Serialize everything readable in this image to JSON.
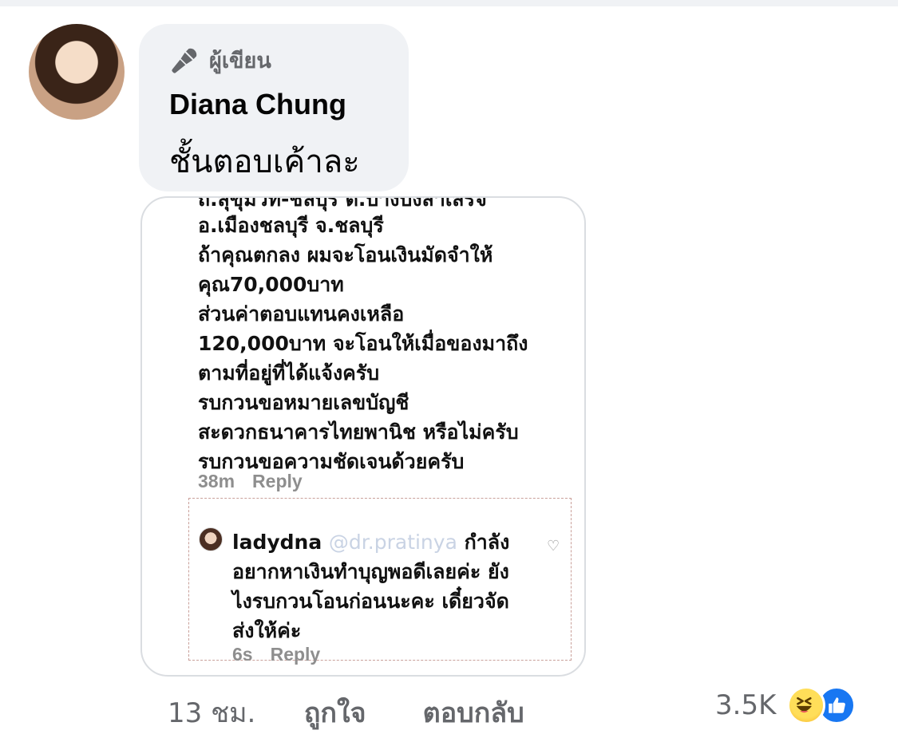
{
  "comment": {
    "badge_label": "ผู้เขียน",
    "author": "Diana Chung",
    "text": "ชั้นตอบเค้าละ"
  },
  "screenshot": {
    "cut_line": "ถ.สุขุมวิท-ชลบุรี ต.บ้างบึงสำเสร็จ",
    "lines": [
      "อ.เมืองชลบุรี จ.ชลบุรี",
      "ถ้าคุณตกลง ผมจะโอนเงินมัดจำให้",
      "คุณ70,000บาท",
      "ส่วนค่าตอบแทนคงเหลือ",
      "120,000บาท จะโอนให้เมื่อของมาถึง",
      "ตามที่อยู่ที่ได้แจ้งครับ",
      "รบกวนขอหมายเลขบัญชี",
      "สะดวกธนาคารไทยพานิช หรือไม่ครับ",
      "รบกวนขอความชัดเจนด้วยครับ"
    ],
    "time": "38m",
    "reply_label": "Reply",
    "reply": {
      "username": "ladydna",
      "mention": "@dr.pratinya",
      "first_line_tail": "กำลัง",
      "lines": [
        "อยากหาเงินทำบุญพอดีเลยค่ะ ยัง",
        "ไงรบกวนโอนก่อนนะคะ เดี๋ยวจัด",
        "ส่งให้ค่ะ"
      ],
      "time": "6s",
      "reply_label": "Reply"
    }
  },
  "footer": {
    "time": "13 ชม.",
    "like": "ถูกใจ",
    "reply": "ตอบกลับ",
    "reaction_count": "3.5K"
  }
}
